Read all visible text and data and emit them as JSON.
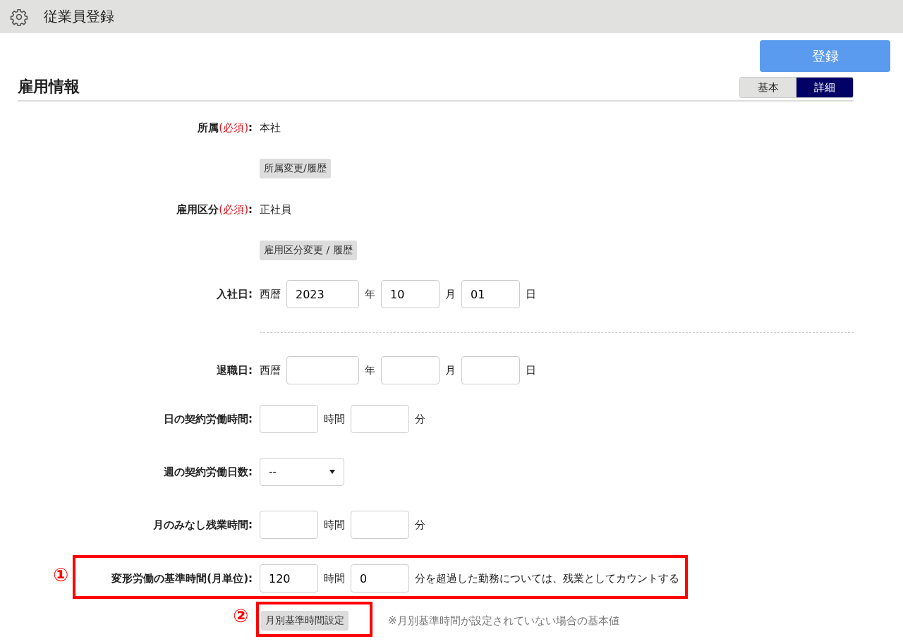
{
  "header": {
    "title": "従業員登録"
  },
  "register_button": "登録",
  "section": {
    "title": "雇用情報"
  },
  "tabs": [
    {
      "label": "基本",
      "selected": false
    },
    {
      "label": "詳細",
      "selected": true
    }
  ],
  "fields": [
    {
      "kind": "text",
      "label": "所属",
      "required": "(必須)",
      "tail": ":",
      "value": "本社"
    },
    {
      "kind": "button",
      "button": "所属変更/履歴"
    },
    {
      "kind": "text",
      "label": "雇用区分",
      "required": "(必須)",
      "tail": ":",
      "value": "正社員"
    },
    {
      "kind": "button",
      "button": "雇用区分変更 / 履歴"
    },
    {
      "kind": "date",
      "label": "入社日:",
      "era": "西暦",
      "year": "2023",
      "year_unit": "年",
      "month": "10",
      "month_unit": "月",
      "day": "01",
      "day_unit": "日"
    },
    {
      "kind": "divider"
    },
    {
      "kind": "date",
      "label": "退職日:",
      "era": "西暦",
      "year_unit": "年",
      "month_unit": "月",
      "day_unit": "日"
    },
    {
      "kind": "time",
      "label": "日の契約労働時間:",
      "hour_unit": "時間",
      "minute_unit": "分"
    },
    {
      "kind": "select",
      "label": "週の契約労働日数:",
      "value": "--"
    },
    {
      "kind": "time",
      "label": "月のみなし残業時間:",
      "hour_unit": "時間",
      "minute_unit": "分"
    },
    {
      "kind": "threshold",
      "label": "変形労働の基準時間(月単位):",
      "hours": "120",
      "hour_unit": "時間",
      "minutes": "0",
      "suffix": "分を超過した勤務については、残業としてカウントする",
      "annotation": "①"
    },
    {
      "kind": "button_note",
      "button": "月別基準時間設定",
      "note": "※月別基準時間が設定されていない場合の基本値",
      "annotation": "②"
    }
  ]
}
